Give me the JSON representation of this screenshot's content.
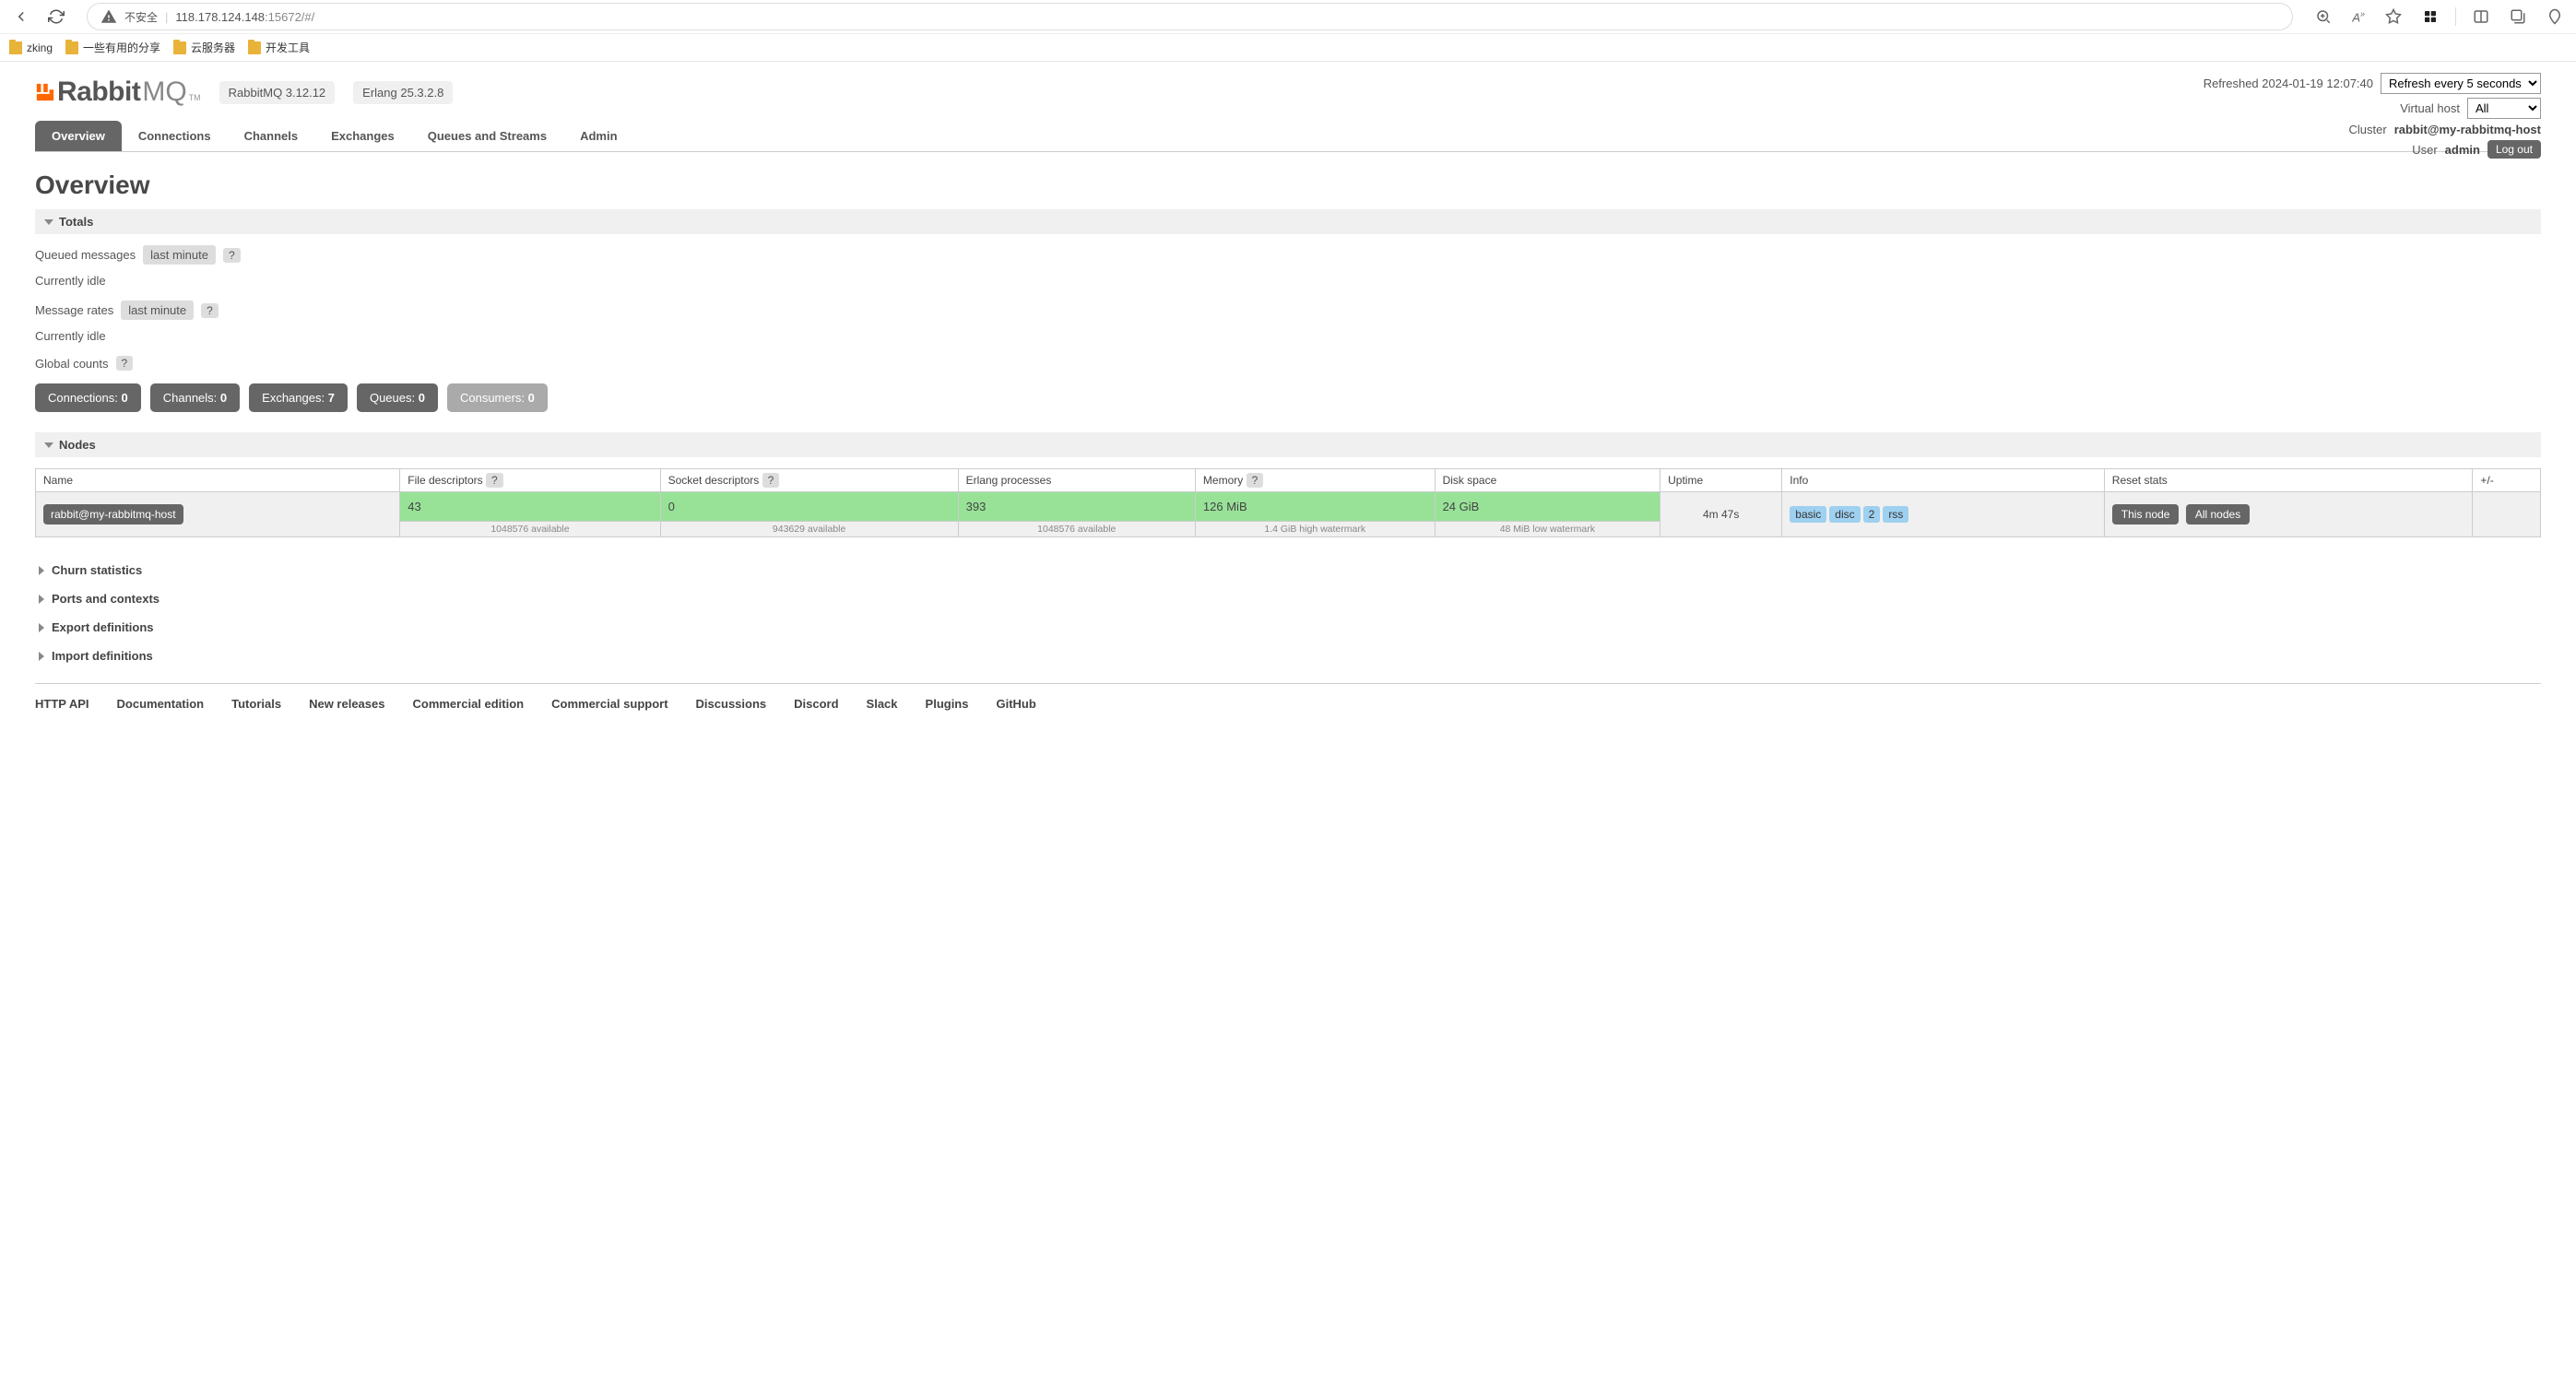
{
  "browser": {
    "insecure_label": "不安全",
    "url_host": "118.178.124.148",
    "url_path": ":15672/#/",
    "bookmarks": [
      "zking",
      "一些有用的分享",
      "云服务器",
      "开发工具"
    ]
  },
  "header": {
    "logo_text1": "Rabbit",
    "logo_text2": "MQ",
    "tm": "TM",
    "rabbitmq_version": "RabbitMQ 3.12.12",
    "erlang_version": "Erlang 25.3.2.8",
    "refreshed_label": "Refreshed 2024-01-19 12:07:40",
    "refresh_options": [
      "Refresh every 5 seconds"
    ],
    "vhost_label": "Virtual host",
    "vhost_options": [
      "All"
    ],
    "cluster_label": "Cluster",
    "cluster_name": "rabbit@my-rabbitmq-host",
    "user_label": "User",
    "user_name": "admin",
    "logout": "Log out"
  },
  "tabs": [
    "Overview",
    "Connections",
    "Channels",
    "Exchanges",
    "Queues and Streams",
    "Admin"
  ],
  "page_title": "Overview",
  "sections": {
    "totals": "Totals",
    "nodes": "Nodes",
    "churn": "Churn statistics",
    "ports": "Ports and contexts",
    "export": "Export definitions",
    "import": "Import definitions"
  },
  "totals": {
    "queued_label": "Queued messages",
    "last_minute": "last minute",
    "idle1": "Currently idle",
    "rates_label": "Message rates",
    "idle2": "Currently idle",
    "global_counts": "Global counts",
    "counts": [
      {
        "label": "Connections:",
        "value": "0"
      },
      {
        "label": "Channels:",
        "value": "0"
      },
      {
        "label": "Exchanges:",
        "value": "7"
      },
      {
        "label": "Queues:",
        "value": "0"
      },
      {
        "label": "Consumers:",
        "value": "0"
      }
    ]
  },
  "nodes": {
    "headers": [
      "Name",
      "File descriptors",
      "Socket descriptors",
      "Erlang processes",
      "Memory",
      "Disk space",
      "Uptime",
      "Info",
      "Reset stats",
      "+/-"
    ],
    "row": {
      "name": "rabbit@my-rabbitmq-host",
      "fd": "43",
      "fd_sub": "1048576 available",
      "sd": "0",
      "sd_sub": "943629 available",
      "ep": "393",
      "ep_sub": "1048576 available",
      "mem": "126 MiB",
      "mem_sub": "1.4 GiB high watermark",
      "disk": "24 GiB",
      "disk_sub": "48 MiB low watermark",
      "uptime": "4m 47s",
      "info": [
        "basic",
        "disc",
        "2",
        "rss"
      ],
      "reset1": "This node",
      "reset2": "All nodes"
    }
  },
  "footer": [
    "HTTP API",
    "Documentation",
    "Tutorials",
    "New releases",
    "Commercial edition",
    "Commercial support",
    "Discussions",
    "Discord",
    "Slack",
    "Plugins",
    "GitHub"
  ]
}
